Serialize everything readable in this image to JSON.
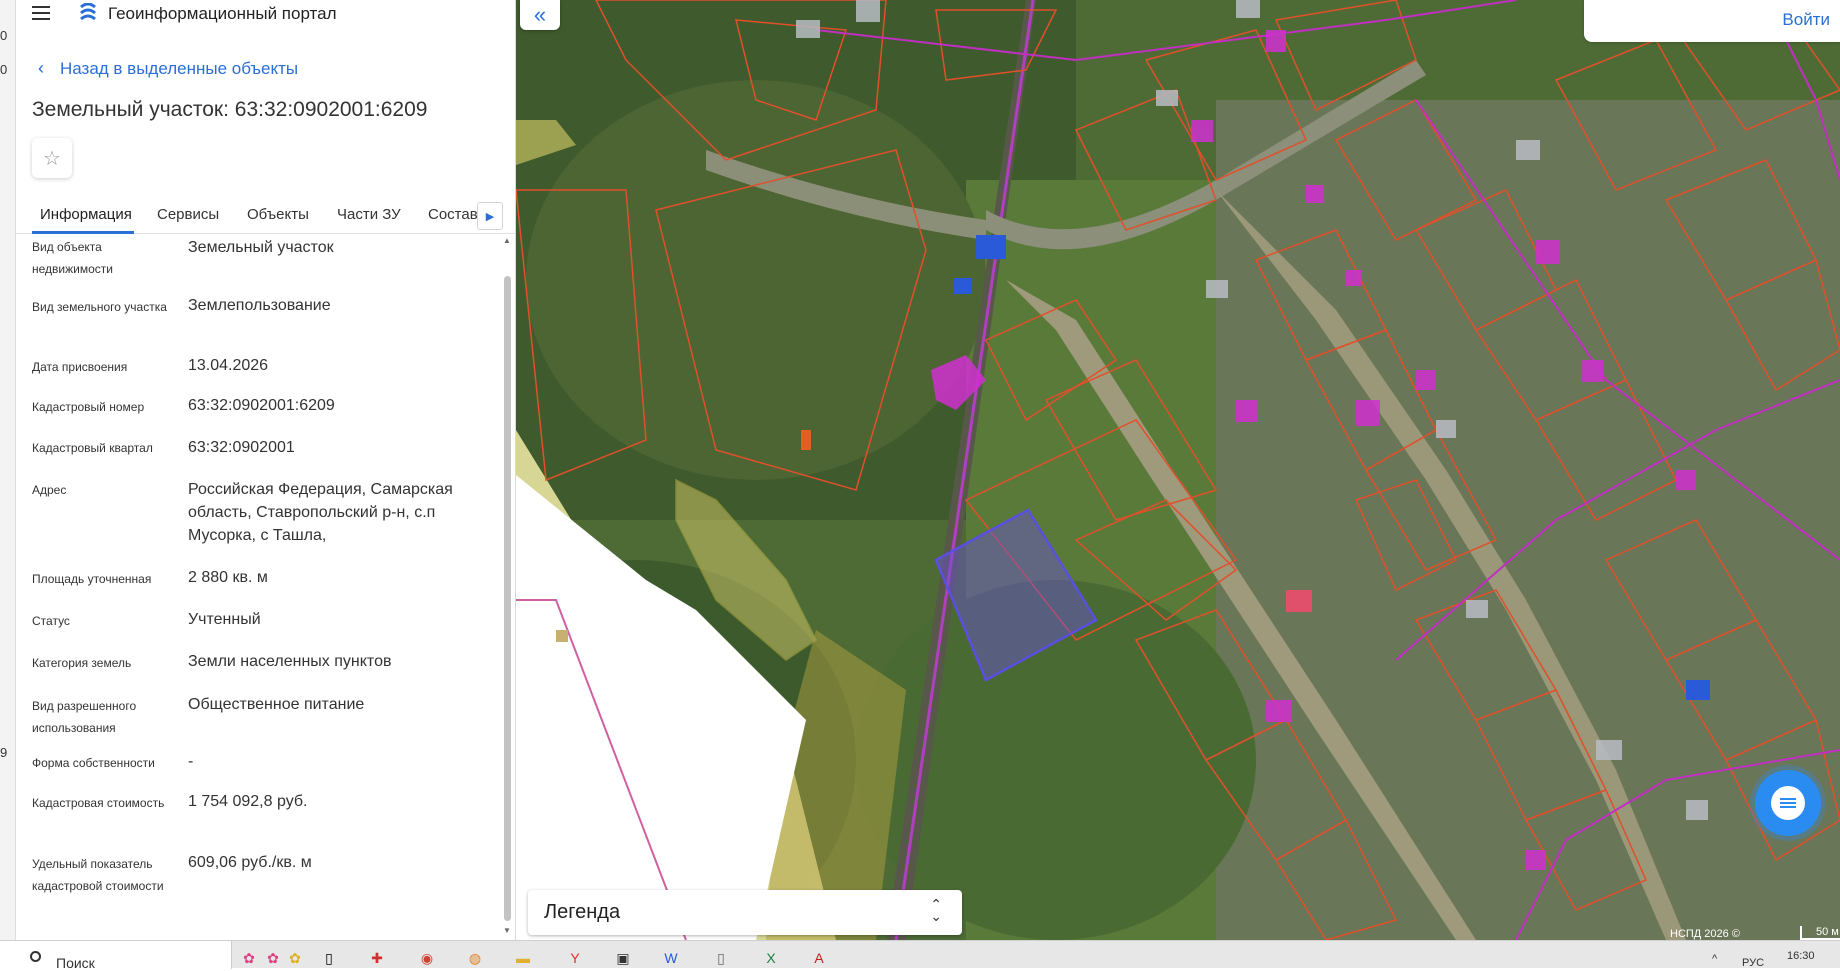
{
  "app": {
    "title": "Геоинформационный портал",
    "back_label": "Назад в выделенные объекты",
    "object_title": "Земельный участок: 63:32:0902001:6209"
  },
  "tabs": [
    {
      "label": "Информация",
      "active": true
    },
    {
      "label": "Сервисы"
    },
    {
      "label": "Объекты"
    },
    {
      "label": "Части ЗУ"
    },
    {
      "label": "Состав"
    }
  ],
  "properties": [
    {
      "label": "Вид объекта недвижимости",
      "value": "Земельный участок"
    },
    {
      "label": "Вид земельного участка",
      "value": "Землепользование"
    },
    {
      "label": "Дата присвоения",
      "value": "13.04.2026"
    },
    {
      "label": "Кадастровый номер",
      "value": "63:32:0902001:6209"
    },
    {
      "label": "Кадастровый квартал",
      "value": "63:32:0902001"
    },
    {
      "label": "Адрес",
      "value": "Российская Федерация, Самарская область, Ставропольский р-н, с.п Мусорка, с Ташла,"
    },
    {
      "label": "Площадь уточненная",
      "value": "2 880 кв. м"
    },
    {
      "label": "Статус",
      "value": "Учтенный"
    },
    {
      "label": "Категория земель",
      "value": "Земли населенных пунктов"
    },
    {
      "label": "Вид разрешенного использования",
      "value": "Общественное питание"
    },
    {
      "label": "Форма собственности",
      "value": "-"
    },
    {
      "label": "Кадастровая стоимость",
      "value": "1 754 092,8 руб."
    },
    {
      "label": "Удельный показатель кадастровой стоимости",
      "value": "609,06 руб./кв. м"
    }
  ],
  "map": {
    "login_label": "Войти",
    "legend_label": "Легенда",
    "copyright": "НСПД 2026 ©",
    "scale_label": "50 м"
  },
  "taskbar": {
    "search_label": "Поиск",
    "lang": "РУС",
    "time": "16:30"
  },
  "colors": {
    "accent": "#2a6fd6",
    "parcel_border": "#e0502a",
    "selected_parcel": "#5a4fe0",
    "road_magenta": "#c030c0"
  }
}
